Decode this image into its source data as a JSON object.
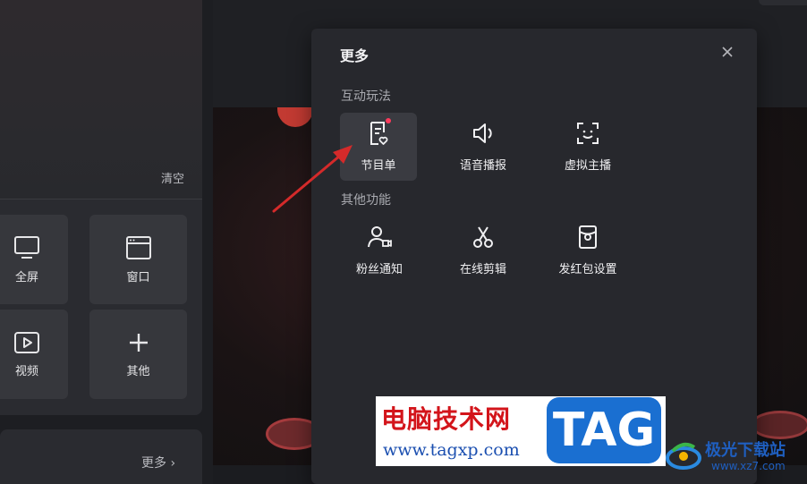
{
  "left_panel": {
    "clear_label": "清空",
    "tiles": [
      {
        "label": "全屏",
        "icon": "monitor-icon"
      },
      {
        "label": "窗口",
        "icon": "window-icon"
      },
      {
        "label": "视频",
        "icon": "video-play-icon"
      },
      {
        "label": "其他",
        "icon": "plus-icon"
      }
    ],
    "more_label": "更多",
    "more_chevron": "›"
  },
  "modal": {
    "title": "更多",
    "close_icon": "close-icon",
    "sections": [
      {
        "label": "互动玩法",
        "items": [
          {
            "label": "节目单",
            "icon": "program-list-icon",
            "selected": true,
            "badge": "red-dot"
          },
          {
            "label": "语音播报",
            "icon": "speaker-icon"
          },
          {
            "label": "虚拟主播",
            "icon": "face-scan-icon"
          }
        ]
      },
      {
        "label": "其他功能",
        "items": [
          {
            "label": "粉丝通知",
            "icon": "user-camera-icon"
          },
          {
            "label": "在线剪辑",
            "icon": "scissors-icon"
          },
          {
            "label": "发红包设置",
            "icon": "red-packet-icon"
          }
        ]
      }
    ]
  },
  "watermark": {
    "title": "电脑技术网",
    "url": "www.tagxp.com",
    "tag": "TAG",
    "site2_name": "极光下载站",
    "site2_url": "www.xz7.com"
  },
  "colors": {
    "modal_bg": "#27282d",
    "badge_red": "#ff3b5c",
    "arrow_red": "#d42a2a"
  }
}
